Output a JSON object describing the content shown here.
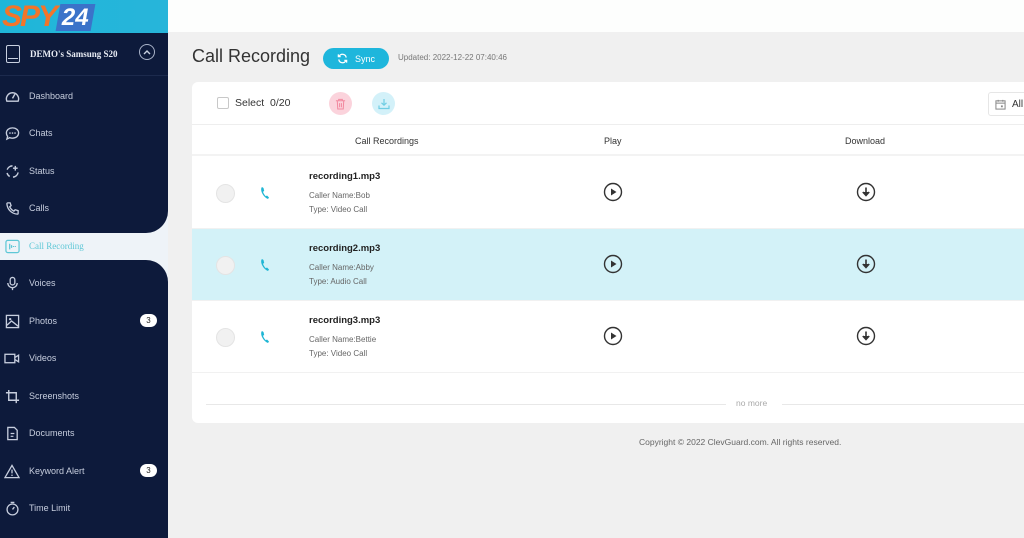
{
  "brand": {
    "logo_text": "SPY",
    "logo_number": "24"
  },
  "device": {
    "name": "DEMO's Samsung S20"
  },
  "sidebar": {
    "items": [
      {
        "label": "Dashboard",
        "icon": "dashboard-icon"
      },
      {
        "label": "Chats",
        "icon": "chat-bubble-icon"
      },
      {
        "label": "Status",
        "icon": "status-icon"
      },
      {
        "label": "Calls",
        "icon": "phone-icon"
      },
      {
        "label": "Call Recording",
        "icon": "call-recording-icon",
        "active": true
      },
      {
        "label": "Voices",
        "icon": "microphone-icon"
      },
      {
        "label": "Photos",
        "icon": "image-icon",
        "badge": "3"
      },
      {
        "label": "Videos",
        "icon": "video-camera-icon"
      },
      {
        "label": "Screenshots",
        "icon": "crop-icon"
      },
      {
        "label": "Documents",
        "icon": "document-icon"
      },
      {
        "label": "Keyword Alert",
        "icon": "warning-icon",
        "badge": "3"
      },
      {
        "label": "Time Limit",
        "icon": "stopwatch-icon"
      }
    ]
  },
  "header": {
    "title": "Call Recording",
    "sync_label": "Sync",
    "updated": "Updated: 2022-12-22 07:40:46"
  },
  "toolbar": {
    "select_label": "Select",
    "select_count": "0/20",
    "date_filter": "All"
  },
  "table": {
    "columns": [
      "Call Recordings",
      "Play",
      "Download"
    ],
    "rows": [
      {
        "file": "recording1.mp3",
        "caller": "Caller Name:Bob",
        "type": "Type: Video Call",
        "highlighted": false
      },
      {
        "file": "recording2.mp3",
        "caller": "Caller Name:Abby",
        "type": "Type: Audio Call",
        "highlighted": true
      },
      {
        "file": "recording3.mp3",
        "caller": "Caller Name:Bettie",
        "type": "Type: Video Call",
        "highlighted": false
      }
    ],
    "end_label": "no more"
  },
  "footer": {
    "copyright": "Copyright © 2022 ClevGuard.com. All rights reserved."
  },
  "colors": {
    "accent": "#1eb6dc",
    "sidebar_dark": "#0d1a3b",
    "brand_orange": "#f2752a",
    "row_highlight": "#d3f2f8"
  }
}
